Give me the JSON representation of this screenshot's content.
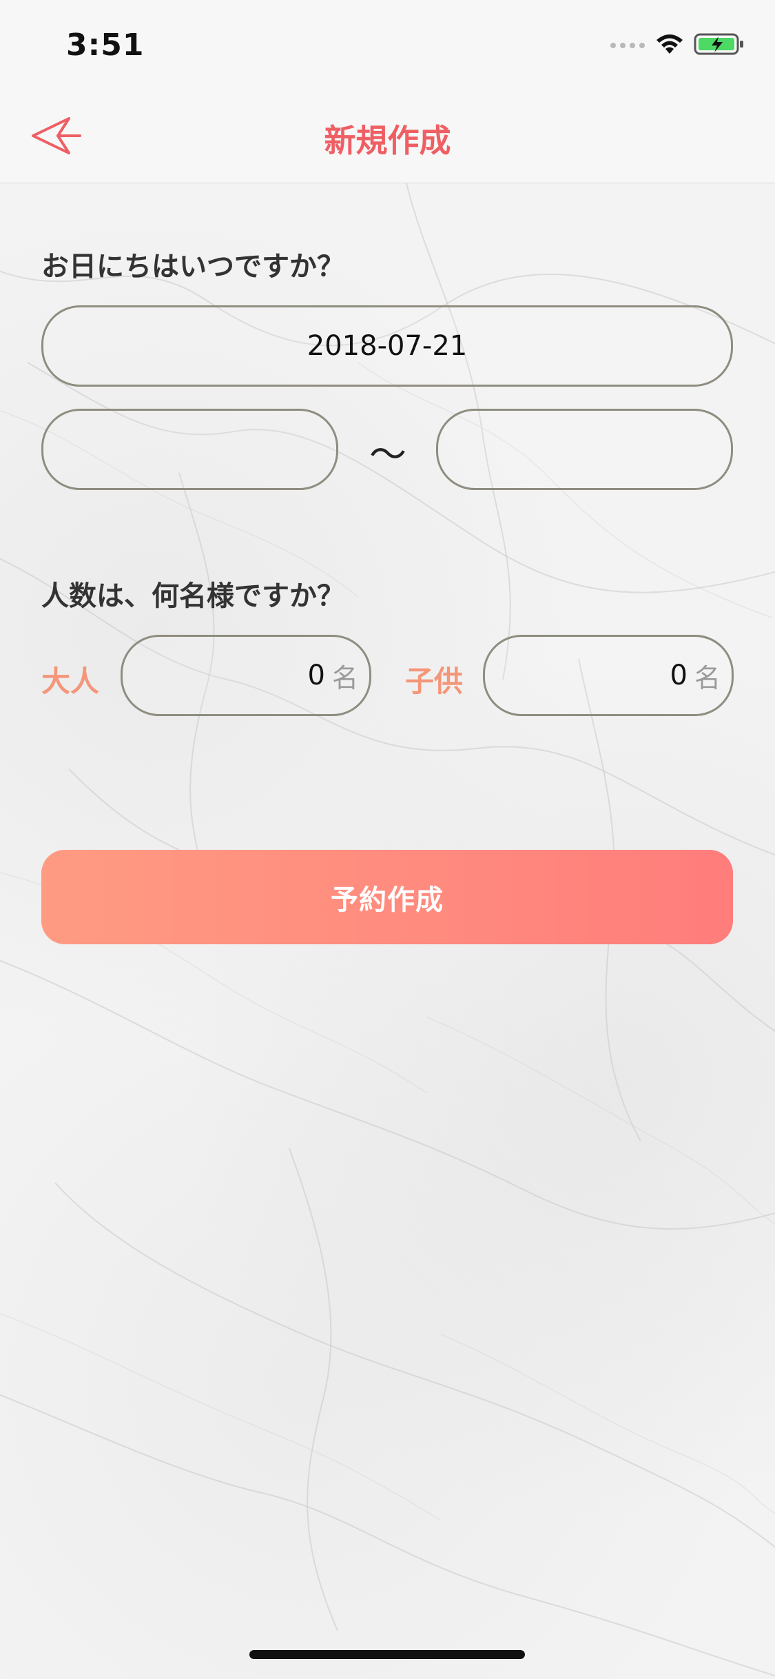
{
  "status_bar": {
    "time": "3:51"
  },
  "nav": {
    "back_icon": "back-arrow-icon",
    "title": "新規作成"
  },
  "date_section": {
    "question": "お日にちはいつですか？",
    "date_value": "2018-07-21",
    "time_start_value": "",
    "time_end_value": "",
    "range_separator": "〜"
  },
  "people_section": {
    "question": "人数は、何名様ですか？",
    "adult_label": "大人",
    "adult_count": "0",
    "adult_unit": "名",
    "child_label": "子供",
    "child_count": "0",
    "child_unit": "名"
  },
  "submit": {
    "label": "予約作成"
  },
  "colors": {
    "accent": "#ee5f64",
    "label_orange": "#f4967a",
    "button_gradient_start": "#ff9b82",
    "button_gradient_end": "#ff7d7b"
  }
}
